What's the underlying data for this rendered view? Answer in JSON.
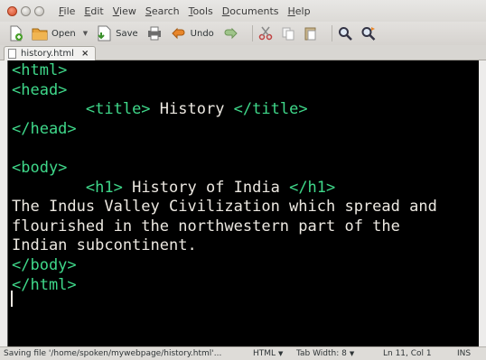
{
  "menubar": {
    "items": [
      {
        "label": "File",
        "key": "F",
        "rest": "ile"
      },
      {
        "label": "Edit",
        "key": "E",
        "rest": "dit"
      },
      {
        "label": "View",
        "key": "V",
        "rest": "iew"
      },
      {
        "label": "Search",
        "key": "S",
        "rest": "earch"
      },
      {
        "label": "Tools",
        "key": "T",
        "rest": "ools"
      },
      {
        "label": "Documents",
        "key": "D",
        "rest": "ocuments"
      },
      {
        "label": "Help",
        "key": "H",
        "rest": "elp"
      }
    ]
  },
  "toolbar": {
    "open_label": "Open",
    "save_label": "Save",
    "undo_label": "Undo"
  },
  "tabs": [
    {
      "label": "history.html"
    }
  ],
  "editor": {
    "lines": [
      [
        {
          "t": "tag",
          "v": "<html>"
        }
      ],
      [
        {
          "t": "tag",
          "v": "<head>"
        }
      ],
      [
        {
          "t": "txt",
          "v": "        "
        },
        {
          "t": "tag",
          "v": "<title>"
        },
        {
          "t": "txt",
          "v": " History "
        },
        {
          "t": "tag",
          "v": "</title>"
        }
      ],
      [
        {
          "t": "tag",
          "v": "</head>"
        }
      ],
      [],
      [
        {
          "t": "tag",
          "v": "<body>"
        }
      ],
      [
        {
          "t": "txt",
          "v": "        "
        },
        {
          "t": "tag",
          "v": "<h1>"
        },
        {
          "t": "txt",
          "v": " History of India "
        },
        {
          "t": "tag",
          "v": "</h1>"
        }
      ],
      [
        {
          "t": "txt",
          "v": "The Indus Valley Civilization which spread and"
        }
      ],
      [
        {
          "t": "txt",
          "v": "flourished in the northwestern part of the"
        }
      ],
      [
        {
          "t": "txt",
          "v": "Indian subcontinent."
        }
      ],
      [
        {
          "t": "tag",
          "v": "</body>"
        }
      ],
      [
        {
          "t": "tag",
          "v": "</html>"
        }
      ]
    ]
  },
  "statusbar": {
    "message": "Saving file '/home/spoken/mywebpage/history.html'...",
    "language": "HTML",
    "tab_width": "Tab Width: 8",
    "position": "Ln 11, Col 1",
    "mode": "INS"
  },
  "colors": {
    "editor_background": "#000000",
    "tag_color": "#3fd88a",
    "text_color": "#ece8e1"
  }
}
